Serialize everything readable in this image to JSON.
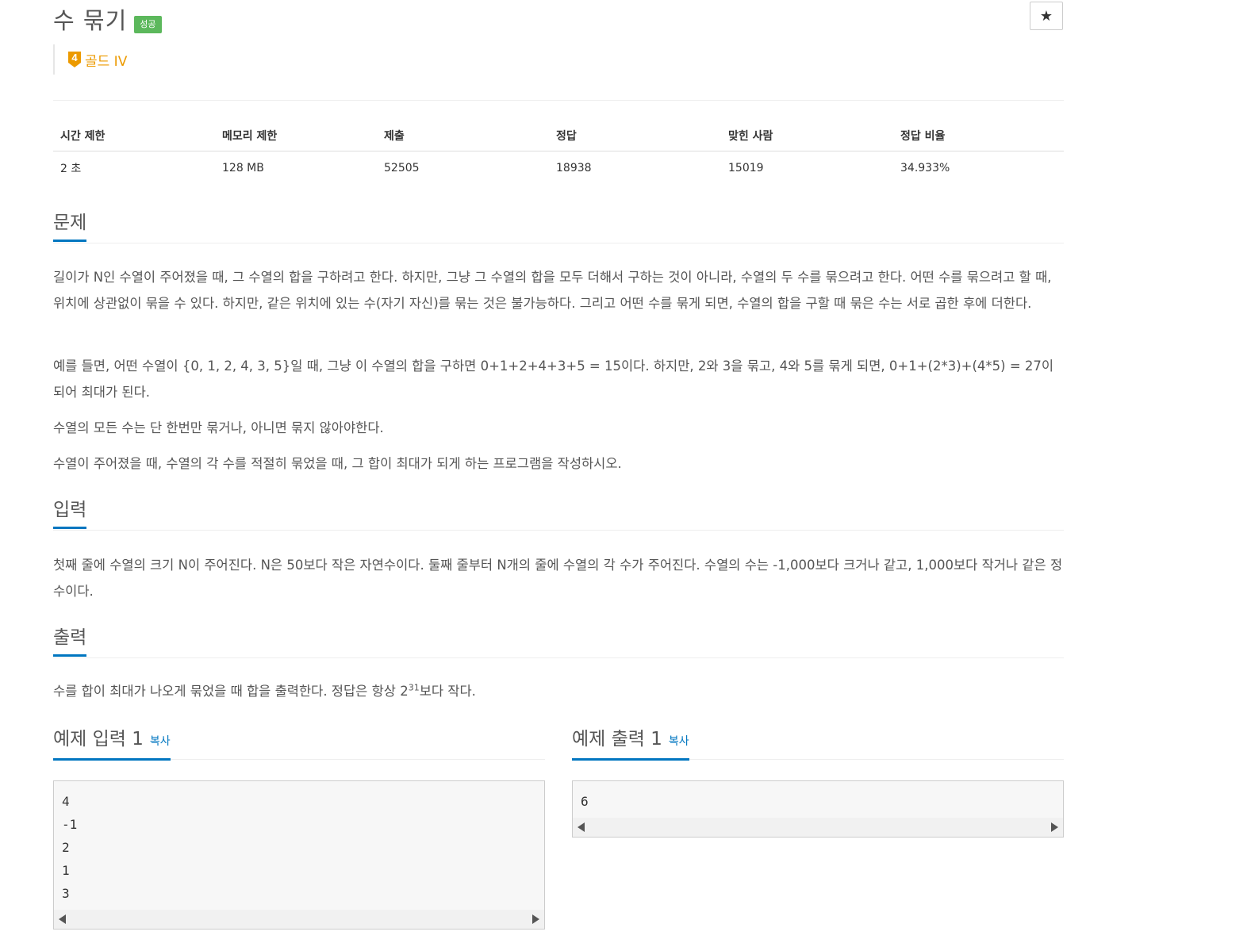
{
  "problem": {
    "title": "수 묶기",
    "status_badge": "성공",
    "star_icon": "★",
    "tier_number": "4",
    "tier_label": "골드 IV",
    "tier_color": "#ec9a00"
  },
  "info_table": {
    "headers": [
      "시간 제한",
      "메모리 제한",
      "제출",
      "정답",
      "맞힌 사람",
      "정답 비율"
    ],
    "values": [
      "2 초",
      "128 MB",
      "52505",
      "18938",
      "15019",
      "34.933%"
    ]
  },
  "sections": {
    "problem_title": "문제",
    "problem_paragraphs": [
      "길이가 N인 수열이 주어졌을 때, 그 수열의 합을 구하려고 한다. 하지만, 그냥 그 수열의 합을 모두 더해서 구하는 것이 아니라, 수열의 두 수를 묶으려고 한다. 어떤 수를 묶으려고 할 때, 위치에 상관없이 묶을 수 있다. 하지만, 같은 위치에 있는 수(자기 자신)를 묶는 것은 불가능하다. 그리고 어떤 수를 묶게 되면, 수열의 합을 구할 때 묶은 수는 서로 곱한 후에 더한다.",
      "예를 들면, 어떤 수열이 {0, 1, 2, 4, 3, 5}일 때, 그냥 이 수열의 합을 구하면 0+1+2+4+3+5 = 15이다. 하지만, 2와 3을 묶고, 4와 5를 묶게 되면, 0+1+(2*3)+(4*5) = 27이 되어 최대가 된다.",
      "수열의 모든 수는 단 한번만 묶거나, 아니면 묶지 않아야한다.",
      "수열이 주어졌을 때, 수열의 각 수를 적절히 묶었을 때, 그 합이 최대가 되게 하는 프로그램을 작성하시오."
    ],
    "input_title": "입력",
    "input_text": "첫째 줄에 수열의 크기 N이 주어진다. N은 50보다 작은 자연수이다. 둘째 줄부터 N개의 줄에 수열의 각 수가 주어진다. 수열의 수는 -1,000보다 크거나 같고, 1,000보다 작거나 같은 정수이다.",
    "output_title": "출력",
    "output_text_before": "수를 합이 최대가 나오게 묶었을 때 합을 출력한다. 정답은 항상 2",
    "output_text_sup": "31",
    "output_text_after": "보다 작다."
  },
  "samples": {
    "input_title": "예제 입력 1",
    "output_title": "예제 출력 1",
    "copy_label": "복사",
    "input_content": "4\n-1\n2\n1\n3",
    "output_content": "6"
  }
}
